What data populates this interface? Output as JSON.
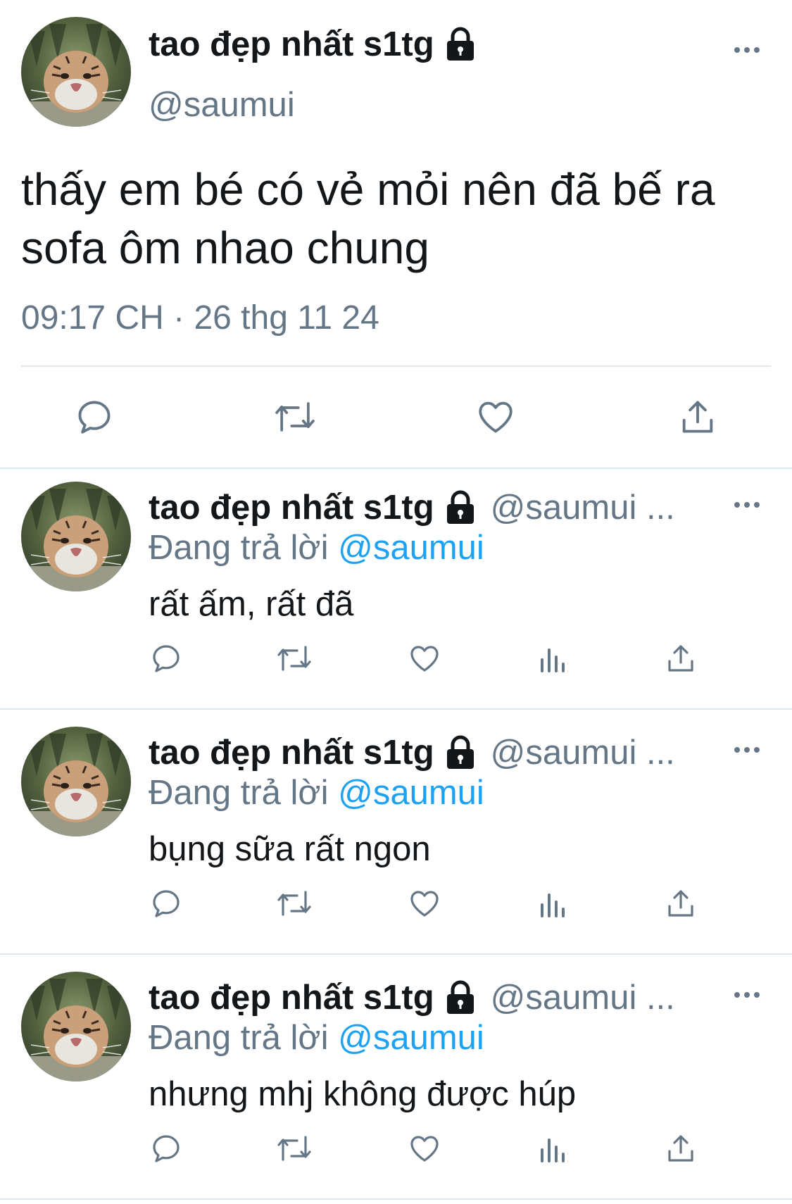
{
  "author": {
    "display_name": "tao đẹp nhất s1tg",
    "handle": "@saumui",
    "avatar_icon": "tiger-avatar",
    "lock_icon": "lock-icon"
  },
  "main_tweet": {
    "text": "thấy em bé có vẻ mỏi nên đã bế ra sofa ôm nhao chung",
    "timestamp": "09:17 CH · 26 thg 11 24",
    "actions": [
      "reply-icon",
      "retweet-icon",
      "like-icon",
      "share-icon"
    ]
  },
  "replies": [
    {
      "display_name": "tao đẹp nhất s1tg",
      "handle": "@saumui ...",
      "replying_prefix": "Đang trả lời",
      "replying_to": "@saumui",
      "text": "rất ấm, rất đã",
      "actions": [
        "reply-icon",
        "retweet-icon",
        "like-icon",
        "analytics-icon",
        "share-icon"
      ]
    },
    {
      "display_name": "tao đẹp nhất s1tg",
      "handle": "@saumui ...",
      "replying_prefix": "Đang trả lời",
      "replying_to": "@saumui",
      "text": "bụng sữa rất ngon",
      "actions": [
        "reply-icon",
        "retweet-icon",
        "like-icon",
        "analytics-icon",
        "share-icon"
      ]
    },
    {
      "display_name": "tao đẹp nhất s1tg",
      "handle": "@saumui ...",
      "replying_prefix": "Đang trả lời",
      "replying_to": "@saumui",
      "text": "nhưng mhj không được húp",
      "actions": [
        "reply-icon",
        "retweet-icon",
        "like-icon",
        "analytics-icon",
        "share-icon"
      ]
    }
  ],
  "colors": {
    "text": "#14171a",
    "secondary": "#657786",
    "link": "#1da1f2",
    "divider": "#e1e8ed"
  }
}
